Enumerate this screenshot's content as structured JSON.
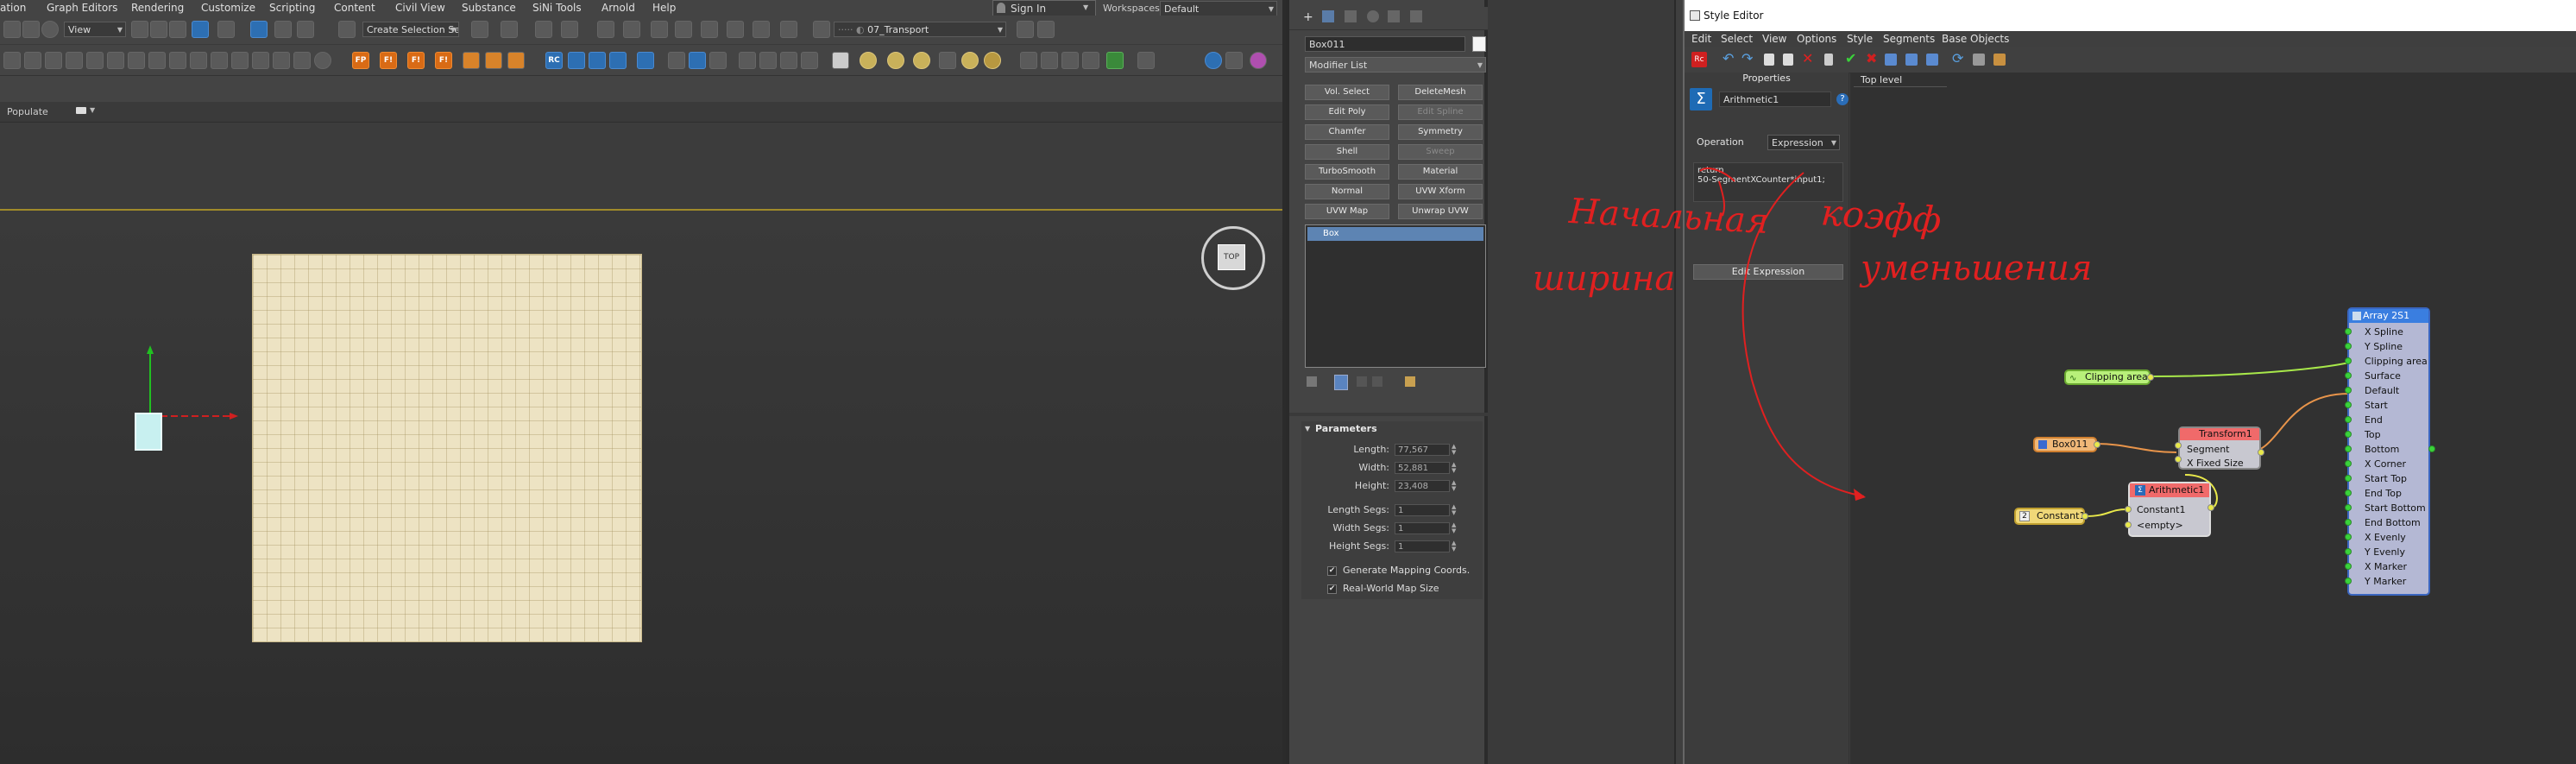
{
  "max": {
    "menu": [
      "ation",
      "Graph Editors",
      "Rendering",
      "Customize",
      "Scripting",
      "Content",
      "Civil View",
      "Substance",
      "SiNi Tools",
      "Arnold",
      "Help"
    ],
    "sign_in": "Sign In",
    "workspaces_label": "Workspaces:",
    "workspace_value": "Default",
    "view_combo": "View",
    "selection_set": "Create Selection Se",
    "layer_combo": "07_Transport",
    "populate_label": "Populate",
    "viewcube_label": "TOP",
    "toolbar2_badges": [
      "FP",
      "F!",
      "F!",
      "F!",
      "RC"
    ]
  },
  "command_panel": {
    "object_name": "Box011",
    "modifier_list": "Modifier List",
    "buttons": [
      {
        "label": "Vol. Select",
        "enabled": true
      },
      {
        "label": "DeleteMesh",
        "enabled": true
      },
      {
        "label": "Edit Poly",
        "enabled": true
      },
      {
        "label": "Edit Spline",
        "enabled": false
      },
      {
        "label": "Chamfer",
        "enabled": true
      },
      {
        "label": "Symmetry",
        "enabled": true
      },
      {
        "label": "Shell",
        "enabled": true
      },
      {
        "label": "Sweep",
        "enabled": false
      },
      {
        "label": "TurboSmooth",
        "enabled": true
      },
      {
        "label": "Material",
        "enabled": true
      },
      {
        "label": "Normal",
        "enabled": true
      },
      {
        "label": "UVW Xform",
        "enabled": true
      },
      {
        "label": "UVW Map",
        "enabled": true
      },
      {
        "label": "Unwrap UVW",
        "enabled": true
      }
    ],
    "stack_item": "Box",
    "parameters_title": "Parameters",
    "params": [
      {
        "label": "Length:",
        "value": "77,567"
      },
      {
        "label": "Width:",
        "value": "52,881"
      },
      {
        "label": "Height:",
        "value": "23,408"
      },
      {
        "label": "Length Segs:",
        "value": "1"
      },
      {
        "label": "Width Segs:",
        "value": "1"
      },
      {
        "label": "Height Segs:",
        "value": "1"
      }
    ],
    "checkboxes": [
      {
        "label": "Generate Mapping Coords.",
        "checked": true
      },
      {
        "label": "Real-World Map Size",
        "checked": true
      }
    ]
  },
  "style_editor": {
    "title": "Style Editor",
    "menu": [
      "Edit",
      "Select",
      "View",
      "Options",
      "Style",
      "Segments",
      "Base Objects"
    ],
    "properties_title": "Properties",
    "node_name": "Arithmetic1",
    "operation_label": "Operation",
    "operation_value": "Expression",
    "expression_line1": "return",
    "expression_line2": "50-SegmentXCounter*input1;",
    "edit_expression_button": "Edit Expression",
    "graph_tab": "Top level",
    "nodes": {
      "array": {
        "title": "Array 2S1",
        "ports": [
          "X Spline",
          "Y Spline",
          "Clipping area",
          "Surface",
          "Default",
          "Start",
          "End",
          "Top",
          "Bottom",
          "X Corner",
          "Start Top",
          "End Top",
          "Start Bottom",
          "End Bottom",
          "X Evenly",
          "Y Evenly",
          "X Marker",
          "Y Marker"
        ]
      },
      "clipping": {
        "label": "Clipping area"
      },
      "box": {
        "label": "Box011"
      },
      "transform": {
        "title": "Transform1",
        "ports": [
          "Segment",
          "X Fixed Size"
        ]
      },
      "arithmetic": {
        "title": "Arithmetic1",
        "ports": [
          "Constant1",
          "<empty>"
        ]
      },
      "constant": {
        "badge": "2",
        "label": "Constant1"
      }
    }
  },
  "annotations": {
    "text1_line1": "Начальная",
    "text1_line2": "ширина",
    "text2_line1": "коэфф",
    "text2_line2": "уменьшения"
  }
}
